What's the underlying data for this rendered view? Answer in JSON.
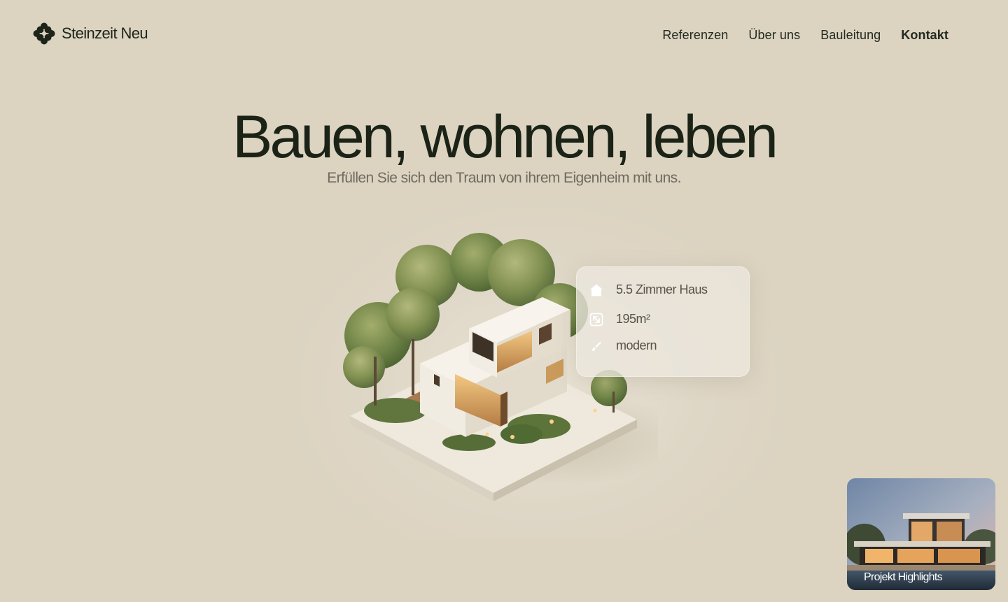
{
  "brand": {
    "name": "Steinzeit Neu",
    "logo_icon": "flower-logo-icon"
  },
  "nav": {
    "items": [
      {
        "label": "Referenzen",
        "active": false
      },
      {
        "label": "Über uns",
        "active": false
      },
      {
        "label": "Bauleitung",
        "active": false
      },
      {
        "label": "Kontakt",
        "active": true
      }
    ]
  },
  "hero": {
    "title": "Bauen, wohnen, leben",
    "subtitle": "Erfüllen Sie sich den Traum von ihrem Eigenheim mit uns."
  },
  "info_card": {
    "items": [
      {
        "icon": "house-icon",
        "text": "5.5 Zimmer Haus"
      },
      {
        "icon": "expand-arrow-icon",
        "text": "195m²"
      },
      {
        "icon": "brush-icon",
        "text": "modern"
      }
    ]
  },
  "project_card": {
    "label": "Projekt Highlights"
  },
  "colors": {
    "background": "#dcd3c1",
    "text_dark": "#1b2317",
    "text_muted": "#6f6a60",
    "card_bg": "#ece7de"
  }
}
